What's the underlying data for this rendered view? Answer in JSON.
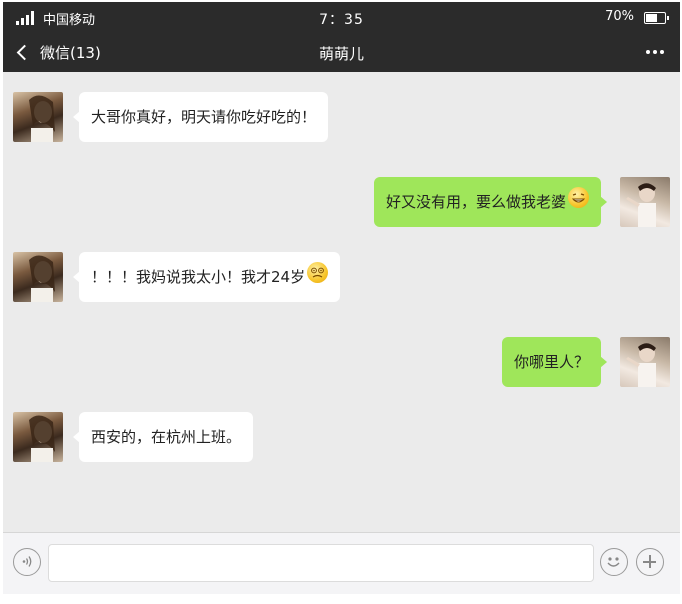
{
  "status_bar": {
    "carrier": "中国移动",
    "time": "7：35",
    "battery_percent": "70%",
    "battery_level": 0.7
  },
  "nav": {
    "back_label": "微信(13)",
    "title": "萌萌儿",
    "icons": {
      "back": "chevron-left-icon",
      "more": "more-dots-icon"
    }
  },
  "messages": [
    {
      "sender": "contact",
      "text": "大哥你真好，明天请你吃好吃的！",
      "emoji": null
    },
    {
      "sender": "me",
      "text": "好又没有用，要么做我老婆",
      "emoji": "grin-emoji"
    },
    {
      "sender": "contact",
      "text": "！！！我妈说我太小！我才24岁",
      "emoji": "dizzy-emoji"
    },
    {
      "sender": "me",
      "text": "你哪里人？",
      "emoji": null
    },
    {
      "sender": "contact",
      "text": "西安的，在杭州上班。",
      "emoji": null
    }
  ],
  "input_bar": {
    "icons": {
      "voice": "voice-icon",
      "emoji": "smile-icon",
      "more": "plus-icon"
    }
  },
  "colors": {
    "header_bg": "#2b2b2b",
    "chat_bg": "#ebebeb",
    "incoming_bubble": "#ffffff",
    "outgoing_bubble": "#9fe65a"
  }
}
